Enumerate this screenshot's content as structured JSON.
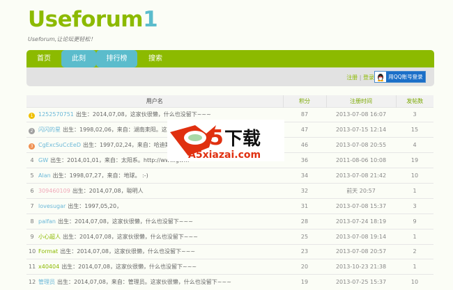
{
  "site": {
    "logo_main": "Useforum",
    "logo_num": "1",
    "slogan": "Useforum,让论坛更轻松！"
  },
  "nav": {
    "tabs": [
      {
        "label": "首页"
      },
      {
        "label": "此刻"
      },
      {
        "label": "排行榜"
      },
      {
        "label": "搜索"
      }
    ]
  },
  "auth": {
    "register": "注册",
    "sep": "|",
    "login": "登录",
    "qq_login": "用QQ账号登录"
  },
  "table": {
    "headers": [
      "用户名",
      "积分",
      "注册时间",
      "发帖数"
    ],
    "rows": [
      {
        "rank": "1",
        "name": "1252570751",
        "color": "#6ab8d8",
        "desc": "出生：2014,07,08，这家伙很懒，什么也没留下~~~",
        "score": "87",
        "time": "2013-07-08 16:07",
        "posts": "3",
        "medal": "#f0c000"
      },
      {
        "rank": "2",
        "name": "闪闪的星",
        "color": "#6ab8d8",
        "desc": "出生：1998,02,06，来自：湖南耒阳。这家伙不…",
        "score": "47",
        "time": "2013-07-15 12:14",
        "posts": "15",
        "medal": "#a0a0a0"
      },
      {
        "rank": "3",
        "name": "CgExcSuCcEeD",
        "color": "#6ab8d8",
        "desc": "出生：1997,02,24，来自：哈迪斯星。",
        "score": "46",
        "time": "2013-07-08 20:55",
        "posts": "4",
        "medal": "#f09050"
      },
      {
        "rank": "4",
        "name": "GW",
        "color": "#6ab8d8",
        "desc": "出生：2014,01,01，来自：太阳系。http://www.gw…",
        "score": "36",
        "time": "2011-08-06 10:08",
        "posts": "19"
      },
      {
        "rank": "5",
        "name": "Alan",
        "color": "#6ab8d8",
        "desc": "出生：1998,07,27，来自：地球。 :-)",
        "score": "34",
        "time": "2013-07-08 21:42",
        "posts": "10"
      },
      {
        "rank": "6",
        "name": "309460109",
        "color": "#f0a8b8",
        "desc": "出生：2014,07,08，聪明人",
        "score": "32",
        "time": "前天 20:57",
        "posts": "1"
      },
      {
        "rank": "7",
        "name": "lovesugar",
        "color": "#6ab8d8",
        "desc": "出生：1997,05,20，",
        "score": "31",
        "time": "2013-07-08 15:37",
        "posts": "3"
      },
      {
        "rank": "8",
        "name": "palfan",
        "color": "#6ab8d8",
        "desc": "出生：2014,07,08，这家伙很懒，什么也没留下~~~",
        "score": "28",
        "time": "2013-07-24 18:19",
        "posts": "9"
      },
      {
        "rank": "9",
        "name": "小心超人",
        "color": "#8cba00",
        "desc": "出生：2014,07,08，这家伙很懒，什么也没留下~~~",
        "score": "25",
        "time": "2013-07-08 19:14",
        "posts": "1"
      },
      {
        "rank": "10",
        "name": "Format",
        "color": "#8cba00",
        "desc": "出生：2014,07,08，这家伙很懒，什么也没留下~~~",
        "score": "23",
        "time": "2013-07-08 20:57",
        "posts": "2"
      },
      {
        "rank": "11",
        "name": "x40404",
        "color": "#8cba00",
        "desc": "出生：2014,07,08，这家伙很懒，什么也没留下~~~",
        "score": "20",
        "time": "2013-10-23 21:38",
        "posts": "1"
      },
      {
        "rank": "12",
        "name": "管理员",
        "color": "#6ab8d8",
        "desc": "出生：2014,07,08，来自：管理员。这家伙很懒，什么也没留下~~~",
        "score": "19",
        "time": "2013-07-25 15:37",
        "posts": "10"
      }
    ]
  },
  "watermark": {
    "brand": "a5下载",
    "url": "A5xiazai.com"
  }
}
